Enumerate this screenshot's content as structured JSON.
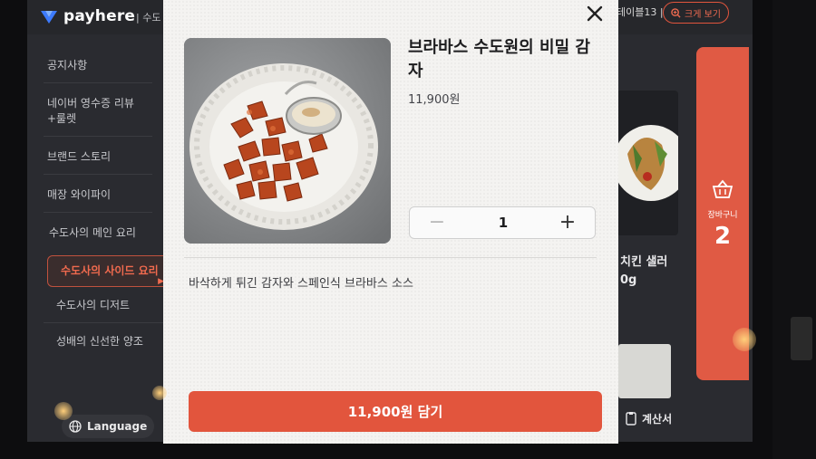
{
  "topbar": {
    "logo_text": "payhere",
    "store_name": "| 수도",
    "table_label": "테이블13 |",
    "zoom_button": "크게 보기"
  },
  "sidebar": {
    "items": [
      {
        "label": "공지사항",
        "active": false
      },
      {
        "label": "네이버 영수증 리뷰+룰렛",
        "active": false
      },
      {
        "label": "브랜드 스토리",
        "active": false
      },
      {
        "label": "매장 와이파이",
        "active": false
      },
      {
        "label": "수도사의 메인 요리",
        "active": false
      },
      {
        "label": "수도사의 사이드 요리",
        "active": true
      },
      {
        "label": "수도사의 디저트",
        "active": false
      },
      {
        "label": "성배의 신선한 양조",
        "active": false
      }
    ],
    "language_button": "Language"
  },
  "background": {
    "card_title": "치킨 샐러",
    "card_subtitle": "0g",
    "receipt_button": "계산서",
    "cart_label": "장바구니",
    "cart_count": "2"
  },
  "modal": {
    "product_name": "브라바스 수도원의 비밀 감자",
    "price": "11,900원",
    "quantity": "1",
    "description": "바삭하게 튀긴 감자와 스페인식 브라바스 소스",
    "add_button": "11,900원 담기"
  },
  "colors": {
    "accent": "#e2553d",
    "screen_bg": "#2a2b30",
    "modal_bg": "#f4f3f1"
  }
}
